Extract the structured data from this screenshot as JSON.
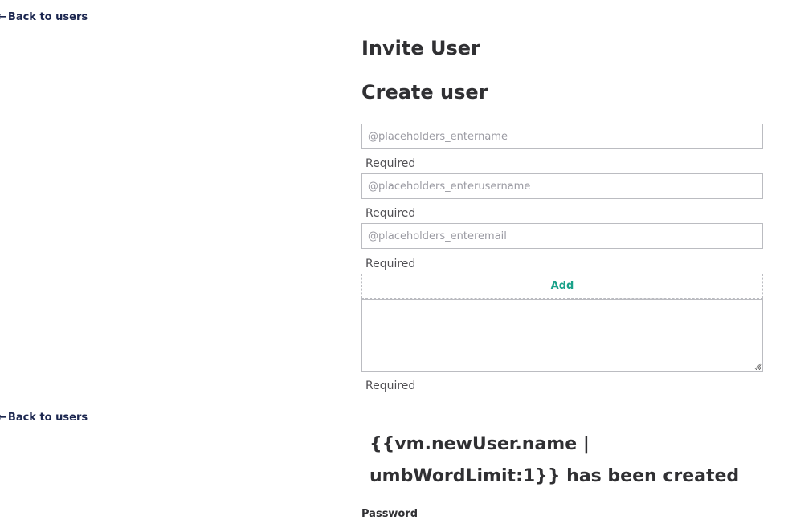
{
  "navigation": {
    "back_arrow": "←",
    "back_label": "Back to users"
  },
  "invite": {
    "title": "Invite User"
  },
  "create": {
    "title": "Create user",
    "name_placeholder": "@placeholders_entername",
    "username_placeholder": "@placeholders_enterusername",
    "email_placeholder": "@placeholders_enteremail",
    "required_label": "Required",
    "add_label": "Add",
    "message_value": ""
  },
  "success": {
    "message": "{{vm.newUser.name | umbWordLimit:1}} has been created",
    "password_label": "Password"
  },
  "colors": {
    "text": "#303033",
    "nav_text": "#1b264f",
    "accent": "#1aa28a",
    "border": "#bbbcc1",
    "placeholder": "#9b9ba3"
  },
  "icons": {
    "back": "arrow-left-icon",
    "resize": "resize-grip-icon"
  }
}
